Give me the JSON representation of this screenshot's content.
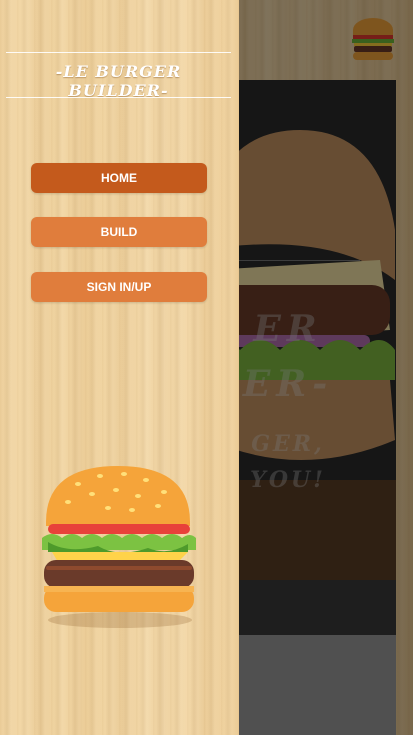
{
  "app": {
    "brand_title": "-LE BURGER BUILDER-"
  },
  "nav": {
    "items": [
      {
        "label": "HOME",
        "active": true
      },
      {
        "label": "BUILD",
        "active": false
      },
      {
        "label": "SIGN IN/UP",
        "active": false
      }
    ]
  },
  "hero": {
    "line1": "ER",
    "line2": "ER-",
    "line3": "GER,",
    "line4": "YOU!"
  },
  "colors": {
    "nav_active": "#c45a1c",
    "nav_normal": "#e07d3c",
    "drawer_wood": "#f3d7a4",
    "overlay": "rgba(0,0,0,0.48)"
  },
  "icons": {
    "header": "burger-logo-icon",
    "drawer": "burger-illustration"
  }
}
